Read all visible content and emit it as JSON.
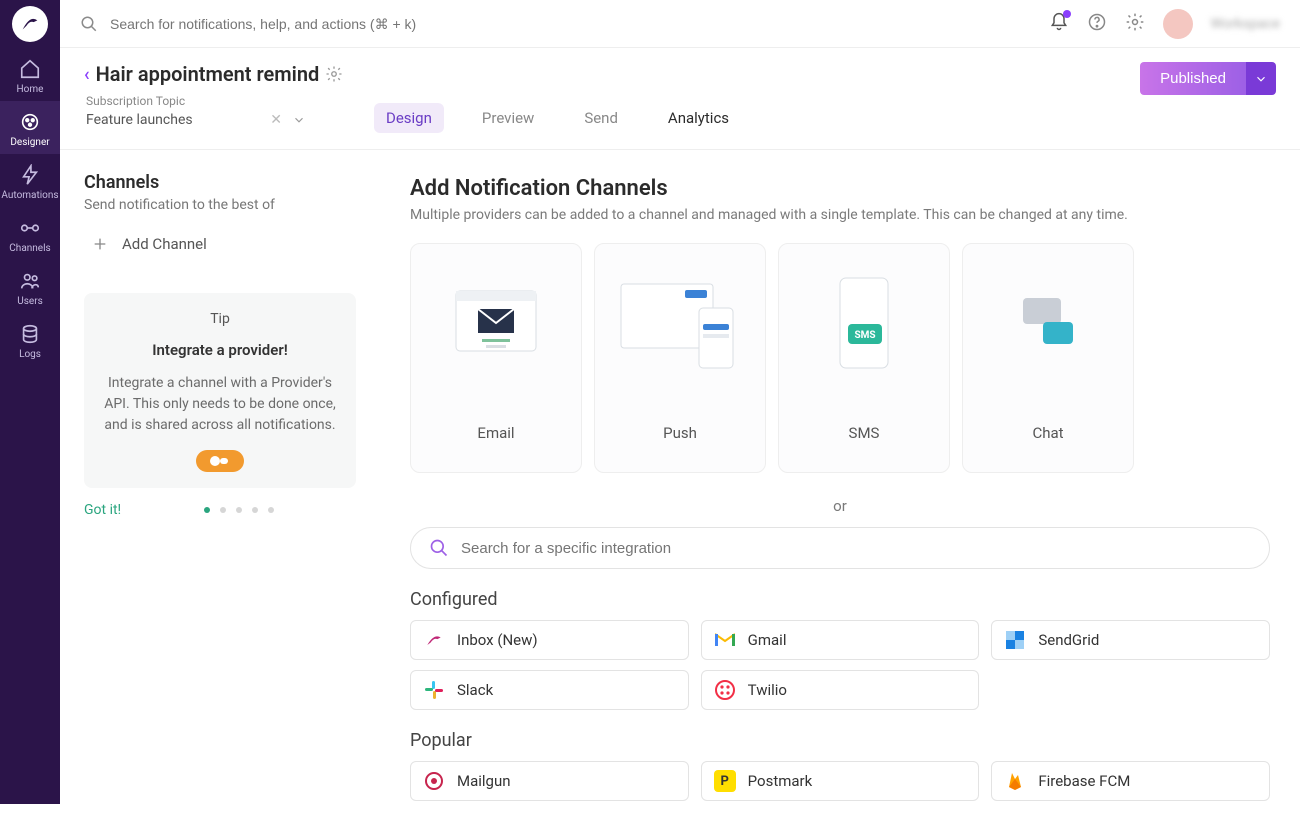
{
  "topbar": {
    "search_placeholder": "Search for notifications, help, and actions (⌘ + k)",
    "workspace": "Workspace"
  },
  "sidebar": {
    "items": [
      {
        "label": "Home"
      },
      {
        "label": "Designer"
      },
      {
        "label": "Automations"
      },
      {
        "label": "Channels"
      },
      {
        "label": "Users"
      },
      {
        "label": "Logs"
      }
    ]
  },
  "page": {
    "title": "Hair appointment remind",
    "subscription_label": "Subscription Topic",
    "subscription_value": "Feature launches",
    "tabs": [
      {
        "label": "Design"
      },
      {
        "label": "Preview"
      },
      {
        "label": "Send"
      },
      {
        "label": "Analytics"
      }
    ],
    "publish_label": "Published"
  },
  "channels_panel": {
    "title": "Channels",
    "subtitle": "Send notification to the best of",
    "add_channel": "Add Channel"
  },
  "tip": {
    "tag": "Tip",
    "title": "Integrate a provider!",
    "body": "Integrate a channel with a Provider's API. This only needs to be done once, and is shared across all notifications.",
    "gotit": "Got it!"
  },
  "main": {
    "title": "Add Notification Channels",
    "subtitle": "Multiple providers can be added to a channel and managed with a single template. This can be changed at any time.",
    "channel_cards": [
      {
        "label": "Email"
      },
      {
        "label": "Push"
      },
      {
        "label": "SMS"
      },
      {
        "label": "Chat"
      }
    ],
    "or": "or",
    "integration_placeholder": "Search for a specific integration",
    "configured_label": "Configured",
    "configured": [
      {
        "label": "Inbox (New)"
      },
      {
        "label": "Gmail"
      },
      {
        "label": "SendGrid"
      },
      {
        "label": "Slack"
      },
      {
        "label": "Twilio"
      }
    ],
    "popular_label": "Popular",
    "popular": [
      {
        "label": "Mailgun"
      },
      {
        "label": "Postmark"
      },
      {
        "label": "Firebase FCM"
      }
    ]
  }
}
